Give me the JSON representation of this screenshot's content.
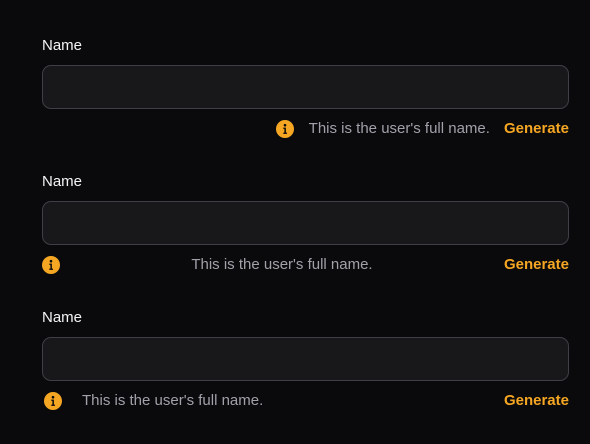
{
  "colors": {
    "background": "#0a0a0c",
    "input_background": "#18181b",
    "input_border": "#3f3f46",
    "accent": "#f5a623",
    "hint_text": "#a1a1aa",
    "label_text": "#f4f4f5"
  },
  "fields": [
    {
      "label": "Name",
      "value": "",
      "placeholder": "",
      "hint_icon": "info-icon",
      "hint": "This is the user's full name.",
      "action": "Generate"
    },
    {
      "label": "Name",
      "value": "",
      "placeholder": "",
      "hint_icon": "info-icon",
      "hint": "This is the user's full name.",
      "action": "Generate"
    },
    {
      "label": "Name",
      "value": "",
      "placeholder": "",
      "hint_icon": "info-icon",
      "hint": "This is the user's full name.",
      "action": "Generate"
    }
  ]
}
